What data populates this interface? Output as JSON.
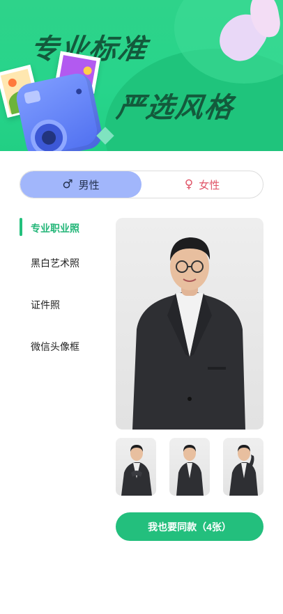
{
  "banner": {
    "line1": "专业标准",
    "line2": "严选风格"
  },
  "gender": {
    "male_symbol": "♂",
    "male_label": "男性",
    "female_symbol": "♀",
    "female_label": "女性",
    "selected": "male"
  },
  "categories": [
    {
      "label": "专业职业照",
      "active": true
    },
    {
      "label": "黑白艺术照",
      "active": false
    },
    {
      "label": "证件照",
      "active": false
    },
    {
      "label": "微信头像框",
      "active": false
    }
  ],
  "preview": {
    "main_image": "portrait-man-suit-glasses",
    "thumbnails": [
      "portrait-pose-1",
      "portrait-pose-2",
      "portrait-pose-3"
    ]
  },
  "cta": {
    "label": "我也要同款（4张）"
  },
  "colors": {
    "accent": "#23bf7d",
    "male_selected": "#a1b6fb",
    "female": "#e05467"
  }
}
